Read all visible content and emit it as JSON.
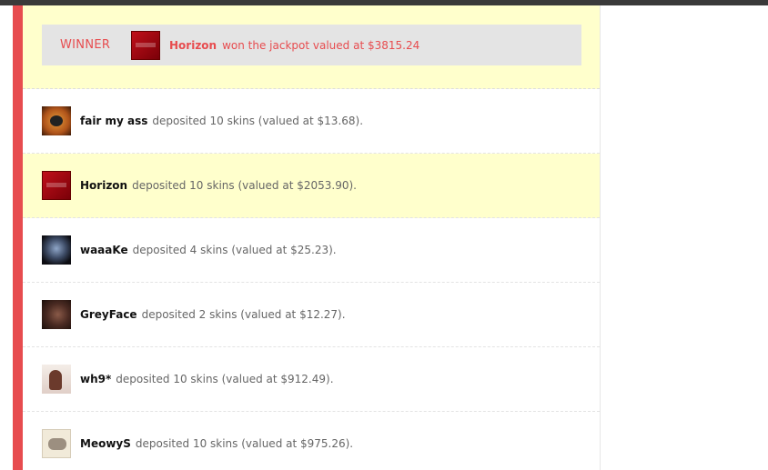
{
  "winner": {
    "label": "WINNER",
    "name": "Horizon",
    "text": "won the jackpot valued at $3815.24"
  },
  "deposits": [
    {
      "name": "fair my ass",
      "text": "deposited 10 skins (valued at $13.68).",
      "avatar": "fair-my-ass-avatar",
      "highlight": false
    },
    {
      "name": "Horizon",
      "text": "deposited 10 skins (valued at $2053.90).",
      "avatar": "horizon-avatar",
      "highlight": true
    },
    {
      "name": "waaaKe",
      "text": "deposited 4 skins (valued at $25.23).",
      "avatar": "waaake-avatar",
      "highlight": false
    },
    {
      "name": "GreyFace",
      "text": "deposited 2 skins (valued at $12.27).",
      "avatar": "greyface-avatar",
      "highlight": false
    },
    {
      "name": "wh9*",
      "text": "deposited 10 skins (valued at $912.49).",
      "avatar": "wh9-avatar",
      "highlight": false
    },
    {
      "name": "MeowyS",
      "text": "deposited 10 skins (valued at $975.26).",
      "avatar": "meowys-avatar",
      "highlight": false
    }
  ],
  "colors": {
    "accent": "#e74c4f",
    "highlight_bg": "#ffffcc",
    "winner_box_bg": "#e4e4e4"
  }
}
